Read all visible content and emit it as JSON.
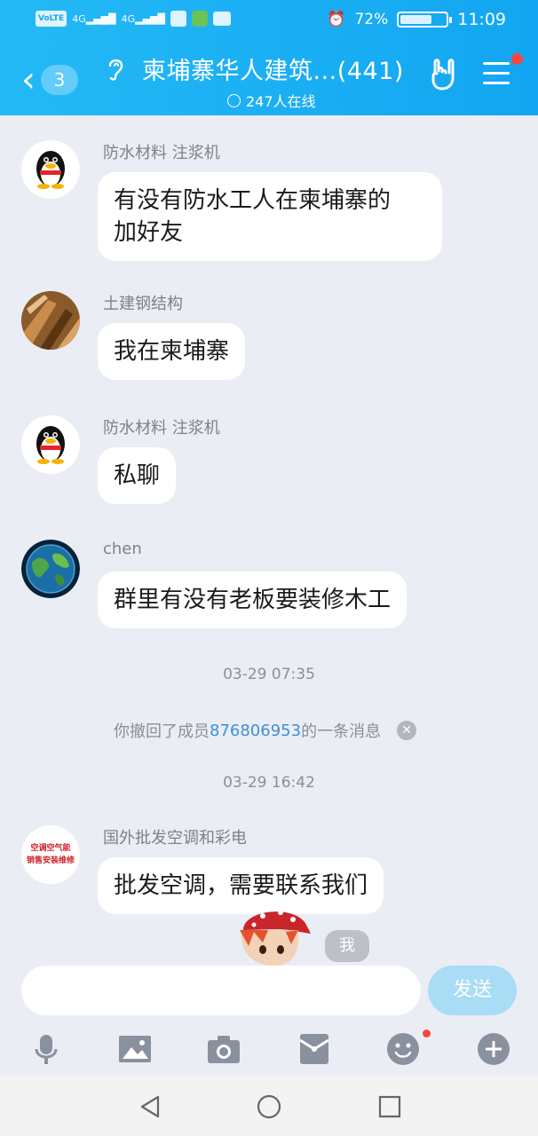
{
  "status_bar": {
    "chip1": "VoLTE",
    "signal1": "4G",
    "signal2": "4G",
    "battery_percent": "72%",
    "battery_level": 0.72,
    "time": "11:09"
  },
  "header": {
    "back_count": "3",
    "title": "柬埔寨华人建筑...(441)",
    "online": "247人在线"
  },
  "messages": [
    {
      "sender": "防水材料 注浆机",
      "text_lines": [
        "有没有防水工人在柬埔寨的",
        "加好友"
      ],
      "avatar": "qq-penguin"
    },
    {
      "sender": "土建钢结构",
      "text_lines": [
        "我在柬埔寨"
      ],
      "avatar": "wood-photo"
    },
    {
      "sender": "防水材料 注浆机",
      "text_lines": [
        "私聊"
      ],
      "avatar": "qq-penguin"
    },
    {
      "sender": "chen",
      "text_lines": [
        "群里有没有老板要装修木工"
      ],
      "avatar": "earth"
    },
    {
      "sender": "国外批发空调和彩电",
      "text_lines": [
        "批发空调，需要联系我们"
      ],
      "avatar": "ac-logo"
    }
  ],
  "timestamps": [
    "03-29 07:35",
    "03-29 16:42"
  ],
  "recall_notice": {
    "prefix": "你撤回了成员",
    "member": "876806953",
    "suffix": "的一条消息"
  },
  "avatar_text": {
    "ac_line1": "空调空气能",
    "ac_line2": "销售安装维修"
  },
  "me_tag": "我",
  "input": {
    "value": "",
    "send_label": "发送"
  },
  "toolbar": [
    "mic-icon",
    "image-icon",
    "camera-icon",
    "red-packet-icon",
    "emoji-icon",
    "plus-icon"
  ],
  "colors": {
    "header": "#12a6f2",
    "link": "#3d8fd6",
    "badge": "#f5473d"
  }
}
